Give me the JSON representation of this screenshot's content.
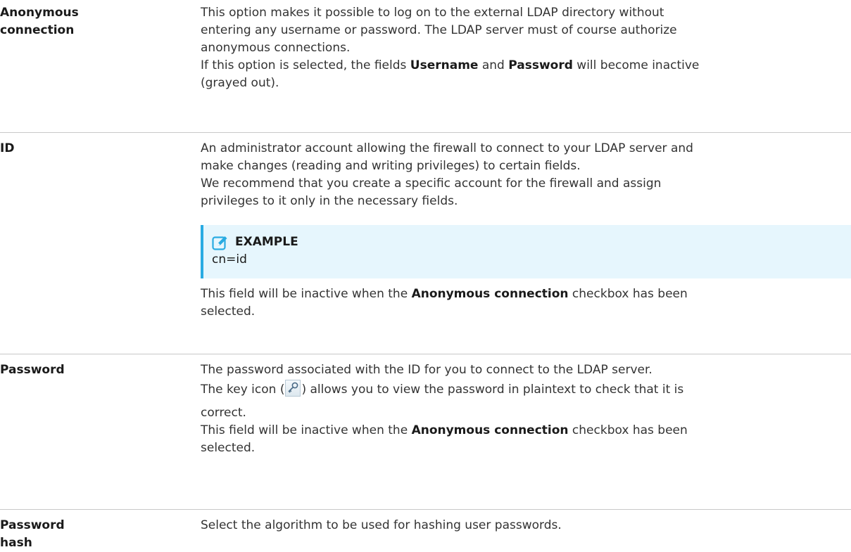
{
  "rows": [
    {
      "term": "Anonymous connection",
      "desc_lines": [
        "This option makes it possible to log on to the external LDAP directory without",
        "entering any username or password. The LDAP server must of course authorize",
        "anonymous connections."
      ],
      "desc_extra_prefix": "If this option is selected, the fields ",
      "desc_extra_bold1": "Username",
      "desc_extra_mid": " and ",
      "desc_extra_bold2": "Password",
      "desc_extra_suffix": " will become inactive",
      "desc_extra_line2": "(grayed out)."
    },
    {
      "term": "ID",
      "desc_lines": [
        "An administrator account allowing the firewall to connect to your LDAP server and",
        "make changes (reading and writing privileges) to certain fields.",
        "We recommend that you create a specific account for the firewall and assign",
        "privileges to it only in the necessary fields."
      ],
      "note": {
        "icon": "edit-icon",
        "title": "EXAMPLE",
        "code": "cn=id"
      },
      "after_prefix": "This field will be inactive when the ",
      "after_bold": "Anonymous connection",
      "after_suffix": " checkbox has been",
      "after_line2": "selected."
    },
    {
      "term": "Password",
      "line1": "The password associated with the ID for you to connect to the LDAP server.",
      "key_prefix": "The key icon (",
      "key_icon": "key-icon",
      "key_suffix": ") allows you to view the password in plaintext to check that it is",
      "key_line2": "correct.",
      "after_prefix": "This field will be inactive when the ",
      "after_bold": "Anonymous connection",
      "after_suffix": " checkbox has been",
      "after_line2": "selected."
    },
    {
      "term": "Password hash",
      "line1": "Select the algorithm to be used for hashing user passwords."
    }
  ],
  "colors": {
    "note_background": "#e6f6fd",
    "note_accent": "#29abe2",
    "divider": "#c8c8c8"
  }
}
